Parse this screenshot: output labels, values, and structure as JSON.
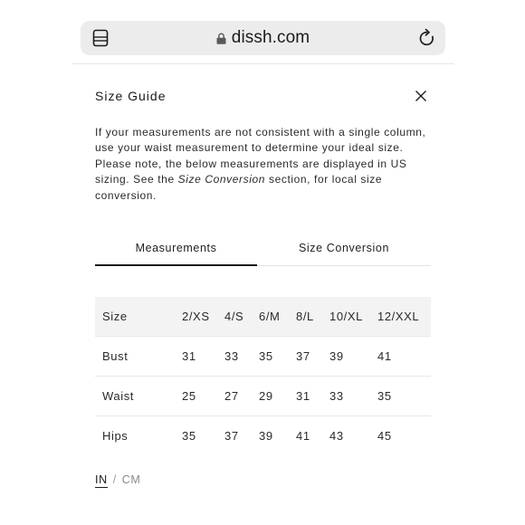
{
  "browser": {
    "url": "dissh.com",
    "icons": {
      "tabs": "tabs-icon",
      "lock": "lock-icon",
      "reload": "reload-icon"
    }
  },
  "modal": {
    "title": "Size Guide",
    "close_icon": "close-icon",
    "description_before": "If your measurements are not consistent with a single column, use your waist measurement to determine your ideal size. Please note, the below measurements are displayed in US sizing. See the ",
    "description_link": "Size Conversion",
    "description_after": " section, for local size conversion.",
    "tabs": [
      {
        "label": "Measurements",
        "active": true
      },
      {
        "label": "Size Conversion",
        "active": false
      }
    ],
    "table": {
      "headers": [
        "Size",
        "2/XS",
        "4/S",
        "6/M",
        "8/L",
        "10/XL",
        "12/XXL"
      ],
      "rows": [
        [
          "Bust",
          "31",
          "33",
          "35",
          "37",
          "39",
          "41"
        ],
        [
          "Waist",
          "25",
          "27",
          "29",
          "31",
          "33",
          "35"
        ],
        [
          "Hips",
          "35",
          "37",
          "39",
          "41",
          "43",
          "45"
        ]
      ]
    },
    "units": {
      "in": "IN",
      "separator": "/",
      "cm": "CM",
      "selected": "IN"
    }
  },
  "colors": {
    "urlbar_bg": "#ececed",
    "header_row_bg": "#f3f3f3",
    "text": "#1a1a1a"
  }
}
